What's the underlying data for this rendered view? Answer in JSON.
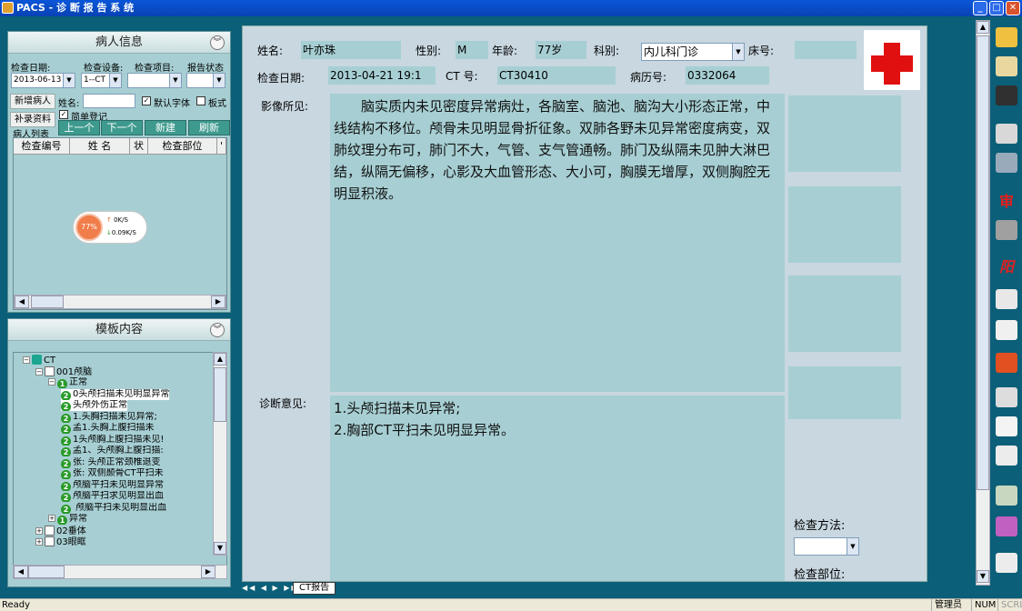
{
  "window": {
    "title": "PACS - 诊 断 报 告 系 统",
    "minimize": "_",
    "maximize": "□",
    "close": "✕"
  },
  "patient_panel": {
    "title": "病人信息",
    "check_date_label": "检查日期:",
    "check_device_label": "检查设备:",
    "check_item_label": "检查项目:",
    "report_status_label": "报告状态",
    "check_date_value": "2013-06-13",
    "check_device_value": "1--CT",
    "check_item_value": "",
    "report_status_value": "",
    "add_patient_btn": "新增病人",
    "supplement_btn": "补录资料",
    "name_label": "姓名:",
    "default_font_label": "默认字体",
    "board_style_label": "板式",
    "simple_register_label": "简单登记",
    "prev_btn": "上一个",
    "next_btn": "下一个",
    "new_btn": "新建",
    "refresh_btn": "刷新",
    "list_group_label": "病人列表",
    "columns": [
      "检查编号",
      "姓 名",
      "状",
      "检查部位",
      "'"
    ]
  },
  "net_widget": {
    "percent": "77%",
    "up": "0K/S",
    "down": "0.09K/S"
  },
  "template_panel": {
    "title": "模板内容",
    "items": [
      {
        "indent": 0,
        "icon": "gem",
        "text": "CT",
        "expander": "−"
      },
      {
        "indent": 1,
        "icon": "doc",
        "text": "001颅脑",
        "expander": "−"
      },
      {
        "indent": 2,
        "icon": "g1",
        "text": "正常",
        "expander": "−"
      },
      {
        "indent": 3,
        "icon": "g2",
        "text": "0头颅扫描未见明显异常",
        "hl": true
      },
      {
        "indent": 3,
        "icon": "g2",
        "text": "头颅外伤正常",
        "hl": true
      },
      {
        "indent": 3,
        "icon": "g2",
        "text": "1.头胸扫描未见异常;"
      },
      {
        "indent": 3,
        "icon": "g2",
        "text": "孟1.头胸上腹扫描未"
      },
      {
        "indent": 3,
        "icon": "g2",
        "text": "1头颅胸上腹扫描未见!"
      },
      {
        "indent": 3,
        "icon": "g2",
        "text": "孟1、头颅胸上腹扫描:"
      },
      {
        "indent": 3,
        "icon": "g2",
        "text": "张: 头颅正常颈椎退变"
      },
      {
        "indent": 3,
        "icon": "g2",
        "text": "张: 双侧颞骨CT平扫未"
      },
      {
        "indent": 3,
        "icon": "g2",
        "text": "颅脑平扫未见明显异常"
      },
      {
        "indent": 3,
        "icon": "g2",
        "text": "颅脑平扫求见明显出血"
      },
      {
        "indent": 3,
        "icon": "g2",
        "text": " 颅脑平扫未见明显出血"
      },
      {
        "indent": 2,
        "icon": "g1",
        "text": "异常",
        "expander": "+"
      },
      {
        "indent": 1,
        "icon": "doc",
        "text": "02垂体",
        "expander": "+"
      },
      {
        "indent": 1,
        "icon": "doc",
        "text": "03眼眶",
        "expander": "+"
      }
    ]
  },
  "report": {
    "name_label": "姓名:",
    "name_value": "叶亦珠",
    "sex_label": "性别:",
    "sex_value": "M",
    "age_label": "年龄:",
    "age_value": "77岁",
    "dept_label": "科别:",
    "dept_value": "内儿科门诊",
    "bed_label": "床号:",
    "bed_value": "",
    "date_label": "检查日期:",
    "date_value": "2013-04-21 19:1",
    "ct_no_label": "CT 号:",
    "ct_no_value": "CT30410",
    "record_label": "病历号:",
    "record_value": "0332064",
    "findings_label": "影像所见:",
    "findings_text": "　　脑实质内未见密度异常病灶，各脑室、脑池、脑沟大小形态正常，中线结构不移位。颅骨未见明显骨折征象。双肺各野未见异常密度病变，双肺纹理分布可，肺门不大，气管、支气管通畅。肺门及纵隔未见肿大淋巴结，纵隔无偏移，心影及大血管形态、大小可，胸膜无增厚，双侧胸腔无明显积液。",
    "diagnosis_label": "诊断意见:",
    "diagnosis_lines": [
      "1.头颅扫描未见异常;",
      "2.胸部CT平扫未见明显异常。"
    ],
    "method_label": "检查方法:",
    "part_label": "检查部位:"
  },
  "tabs": {
    "nav": "◀◀ ◀ ▶ ▶▶",
    "active": "CT报告"
  },
  "status": {
    "ready": "Ready",
    "user": "管理员",
    "num": "NUM",
    "scrl": "SCRL"
  },
  "colors": {
    "background": "#0b5f78",
    "panel": "#a7cfd3",
    "button": "#3e9a8e",
    "titlebar": "#0a56d8"
  }
}
